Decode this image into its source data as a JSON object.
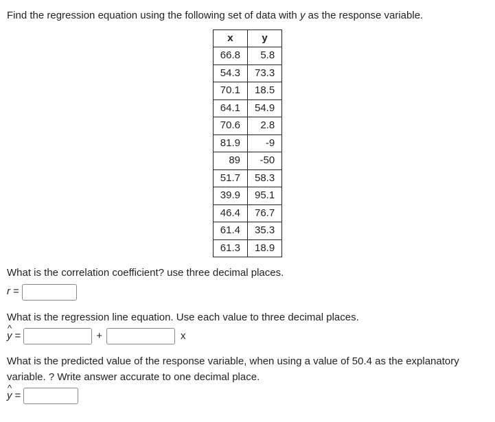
{
  "intro": "Find the regression equation using the following set of data with ",
  "intro_var": "y",
  "intro_end": " as the response variable.",
  "table": {
    "headers": {
      "x": "x",
      "y": "y"
    },
    "rows": [
      {
        "x": "66.8",
        "y": "5.8"
      },
      {
        "x": "54.3",
        "y": "73.3"
      },
      {
        "x": "70.1",
        "y": "18.5"
      },
      {
        "x": "64.1",
        "y": "54.9"
      },
      {
        "x": "70.6",
        "y": "2.8"
      },
      {
        "x": "81.9",
        "y": "-9"
      },
      {
        "x": "89",
        "y": "-50"
      },
      {
        "x": "51.7",
        "y": "58.3"
      },
      {
        "x": "39.9",
        "y": "95.1"
      },
      {
        "x": "46.4",
        "y": "76.7"
      },
      {
        "x": "61.4",
        "y": "35.3"
      },
      {
        "x": "61.3",
        "y": "18.9"
      }
    ]
  },
  "q1": {
    "text": "What is the correlation coefficient? use three decimal places.",
    "label_var": "r",
    "eq": " = "
  },
  "q2": {
    "text": "What is the regression line equation. Use each value to three decimal places.",
    "yhat": "y",
    "eq": " = ",
    "plus": "+",
    "xvar": "x"
  },
  "q3": {
    "text": "What is the predicted value of the response variable, when using a value of 50.4 as the explanatory variable. ?  Write answer accurate to one decimal place.",
    "yhat": "y",
    "eq": " = "
  }
}
